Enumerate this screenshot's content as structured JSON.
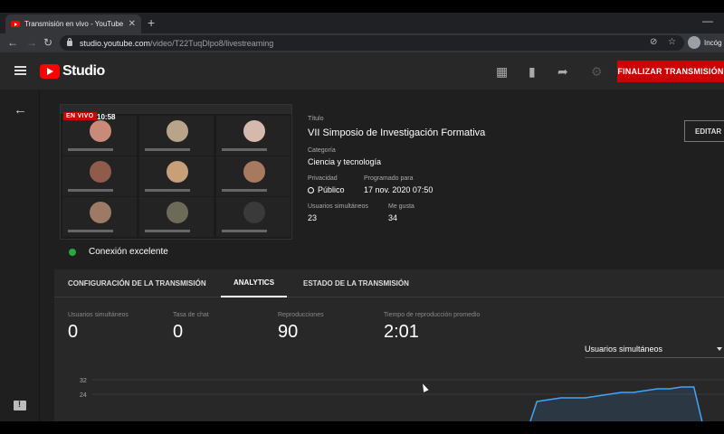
{
  "browser": {
    "tab_title": "Transmisión en vivo - YouTube St",
    "tab_close": "✕",
    "new_tab": "+",
    "minimize": "—",
    "url_host": "studio.youtube.com",
    "url_path": "/video/T22TuqDlpo8/livestreaming",
    "profile_label": "Incóg"
  },
  "header": {
    "logo_text": "Studio",
    "end_button": "FINALIZAR TRANSMISIÓN"
  },
  "preview": {
    "live_badge": "EN VIVO",
    "time": "10:58",
    "connection": "Conexión excelente",
    "tiles": [
      {
        "color": "#c98a7a"
      },
      {
        "color": "#b8a48a"
      },
      {
        "color": "#d6b9ad"
      },
      {
        "color": "#8f5b4a"
      },
      {
        "color": "#c7a07a"
      },
      {
        "color": "#a77a60"
      },
      {
        "color": "#9c7a66"
      },
      {
        "color": "#6c6a58"
      },
      {
        "color": "#3a3a3a"
      }
    ]
  },
  "details": {
    "title_label": "Título",
    "title": "VII Simposio de Investigación Formativa",
    "category_label": "Categoría",
    "category": "Ciencia y tecnología",
    "privacy_label": "Privacidad",
    "privacy": "Público",
    "scheduled_label": "Programado para",
    "scheduled": "17 nov. 2020 07:50",
    "concurrent_label": "Usuarios simultáneos",
    "concurrent": "23",
    "likes_label": "Me gusta",
    "likes": "34",
    "edit_button": "EDITAR"
  },
  "tabs": [
    {
      "label": "CONFIGURACIÓN DE LA TRANSMISIÓN"
    },
    {
      "label": "ANALYTICS"
    },
    {
      "label": "ESTADO DE LA TRANSMISIÓN"
    }
  ],
  "metrics": [
    {
      "label": "Usuarios simultáneos",
      "value": "0"
    },
    {
      "label": "Tasa de chat",
      "value": "0"
    },
    {
      "label": "Reproducciones",
      "value": "90"
    },
    {
      "label": "Tiempo de reproducción promedio",
      "value": "2:01"
    }
  ],
  "metric_select": "Usuarios simultáneos",
  "colors": {
    "accent_red": "#cc0000",
    "connection_green": "#2ba640",
    "chart_line": "#3ea6ff"
  },
  "chart_data": {
    "type": "area",
    "y_ticks": [
      "32",
      "24"
    ],
    "ylim": [
      0,
      36
    ],
    "values": [
      0,
      0,
      0,
      0,
      0,
      0,
      0,
      0,
      0,
      0,
      0,
      0,
      0,
      0,
      0,
      0,
      0,
      0,
      0,
      0,
      0,
      0,
      0,
      0,
      0,
      0,
      0,
      0,
      0,
      0,
      0,
      0,
      0,
      0,
      0,
      0,
      0,
      0,
      0,
      0,
      20,
      21,
      22,
      22,
      22,
      23,
      24,
      25,
      25,
      26,
      27,
      27,
      28,
      28,
      0
    ],
    "grid": true
  }
}
